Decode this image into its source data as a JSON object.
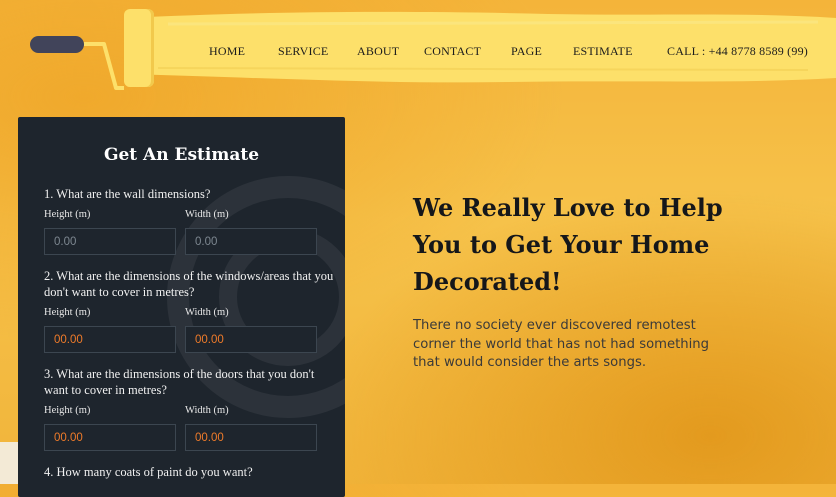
{
  "colors": {
    "accent": "#ef7b2a",
    "panel": "#1e252d",
    "background": "#f4b43a"
  },
  "header": {
    "nav": [
      {
        "label": "HOME"
      },
      {
        "label": "SERVICE"
      },
      {
        "label": "ABOUT"
      },
      {
        "label": "CONTACT"
      },
      {
        "label": "PAGE"
      },
      {
        "label": "ESTIMATE"
      }
    ],
    "phone": "CALL : +44 8778 8589 (99)"
  },
  "estimate": {
    "title": "Get An Estimate",
    "questions": [
      {
        "text": "1. What are the wall dimensions?",
        "height_label": "Height (m)",
        "width_label": "Width (m)",
        "height_value": "0.00",
        "width_value": "0.00"
      },
      {
        "text": "2. What are the dimensions of the windows/areas that you don't want to cover in metres?",
        "height_label": "Height (m)",
        "width_label": "Width (m)",
        "height_value": "00.00",
        "width_value": "00.00"
      },
      {
        "text": "3. What are the dimensions of the doors that you don't want to cover in metres?",
        "height_label": "Height (m)",
        "width_label": "Width (m)",
        "height_value": "00.00",
        "width_value": "00.00"
      },
      {
        "text": "4. How many coats of paint do you want?"
      }
    ]
  },
  "hero": {
    "title": "We Really Love to Help You to Get Your Home Decorated!",
    "text": "There no society ever discovered remotest corner the world that has not had something that would consider the arts songs."
  }
}
